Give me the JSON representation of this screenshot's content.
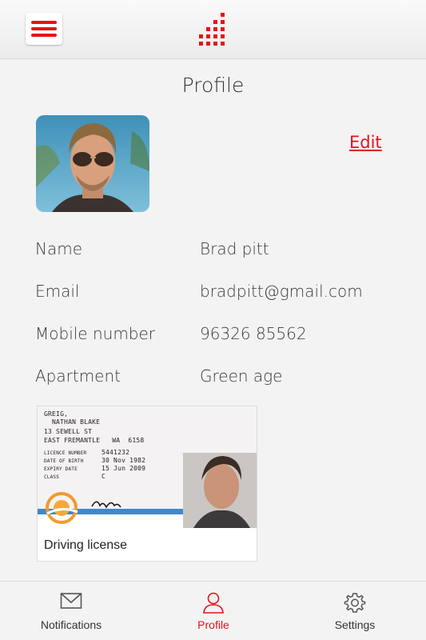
{
  "header": {
    "menu_icon": "hamburger-icon",
    "logo_icon": "brand-logo-icon",
    "accent_color": "#e3141c"
  },
  "page": {
    "title": "Profile",
    "edit_label": "Edit"
  },
  "details": [
    {
      "label": "Name",
      "value": "Brad pitt"
    },
    {
      "label": "Email",
      "value": "bradpitt@gmail.com"
    },
    {
      "label": "Mobile number",
      "value": "96326 85562"
    },
    {
      "label": "Apartment",
      "value": "Green age"
    }
  ],
  "license": {
    "caption": "Driving license",
    "surname": "GREIG,",
    "given_names": "NATHAN BLAKE",
    "address_line1": "13 SEWELL ST",
    "address_line2": "EAST FREMANTLE   WA  6158",
    "fields": [
      {
        "label": "LICENCE NUMBER",
        "value": "5441232"
      },
      {
        "label": "DATE OF BIRTH",
        "value": "30 Nov 1982"
      },
      {
        "label": "EXPIRY DATE",
        "value": "15 Jun 2009"
      },
      {
        "label": "CLASS",
        "value": "C"
      }
    ]
  },
  "nav": {
    "items": [
      {
        "label": "Notifications",
        "icon": "envelope-icon"
      },
      {
        "label": "Profile",
        "icon": "user-icon"
      },
      {
        "label": "Settings",
        "icon": "gear-icon"
      }
    ],
    "active": "Profile"
  }
}
